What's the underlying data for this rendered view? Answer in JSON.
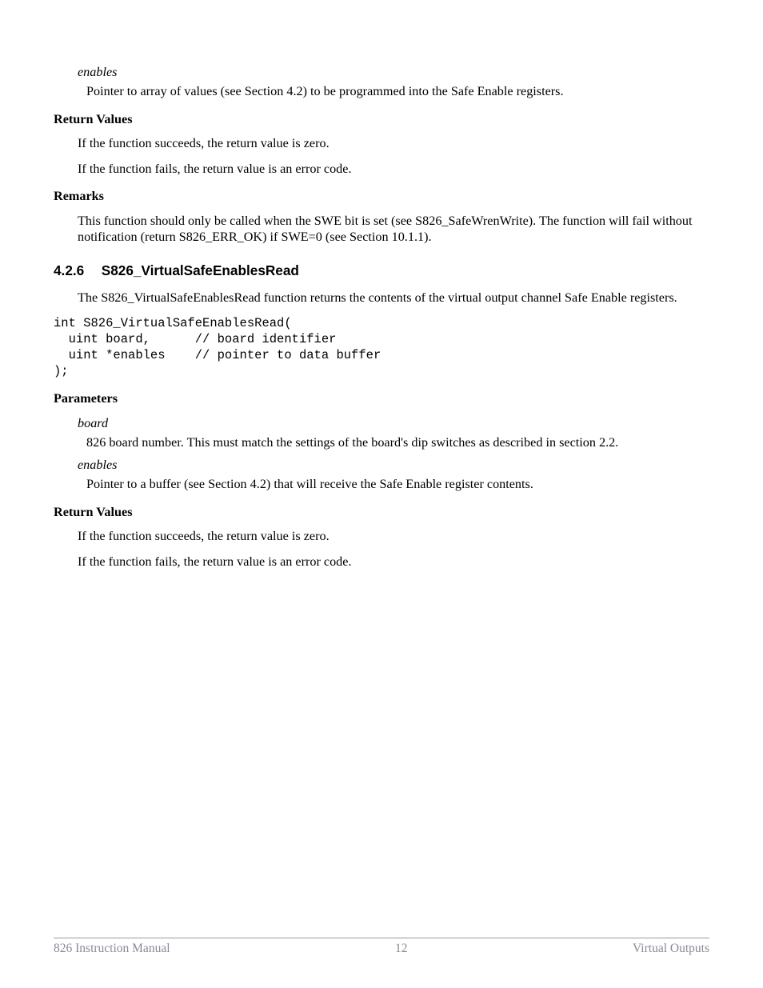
{
  "section1": {
    "param_enables_term": "enables",
    "param_enables_def": "Pointer to array of values (see Section 4.2) to be programmed into the Safe Enable registers.",
    "return_values_heading": "Return Values",
    "return_succeeds": "If the function succeeds, the return value is zero.",
    "return_fails": "If the function fails, the return value is an error code.",
    "remarks_heading": "Remarks",
    "remarks_body": "This function should only be called when the SWE bit is set (see S826_SafeWrenWrite). The function will fail without notification (return S826_ERR_OK) if SWE=0 (see Section 10.1.1)."
  },
  "section2": {
    "number": "4.2.6",
    "title": "S826_VirtualSafeEnablesRead",
    "intro": "The S826_VirtualSafeEnablesRead function returns the contents of the virtual output channel Safe Enable registers.",
    "code": "int S826_VirtualSafeEnablesRead(\n  uint board,      // board identifier\n  uint *enables    // pointer to data buffer\n);",
    "parameters_heading": "Parameters",
    "param_board_term": "board",
    "param_board_def": "826 board number. This must match the settings of the board's dip switches as described in section 2.2.",
    "param_enables_term": "enables",
    "param_enables_def": "Pointer to a buffer (see Section 4.2) that will receive the Safe Enable register contents.",
    "return_values_heading": "Return Values",
    "return_succeeds": "If the function succeeds, the return value is zero.",
    "return_fails": "If the function fails, the return value is an error code."
  },
  "footer": {
    "left": "826 Instruction Manual",
    "center": "12",
    "right": "Virtual Outputs"
  }
}
